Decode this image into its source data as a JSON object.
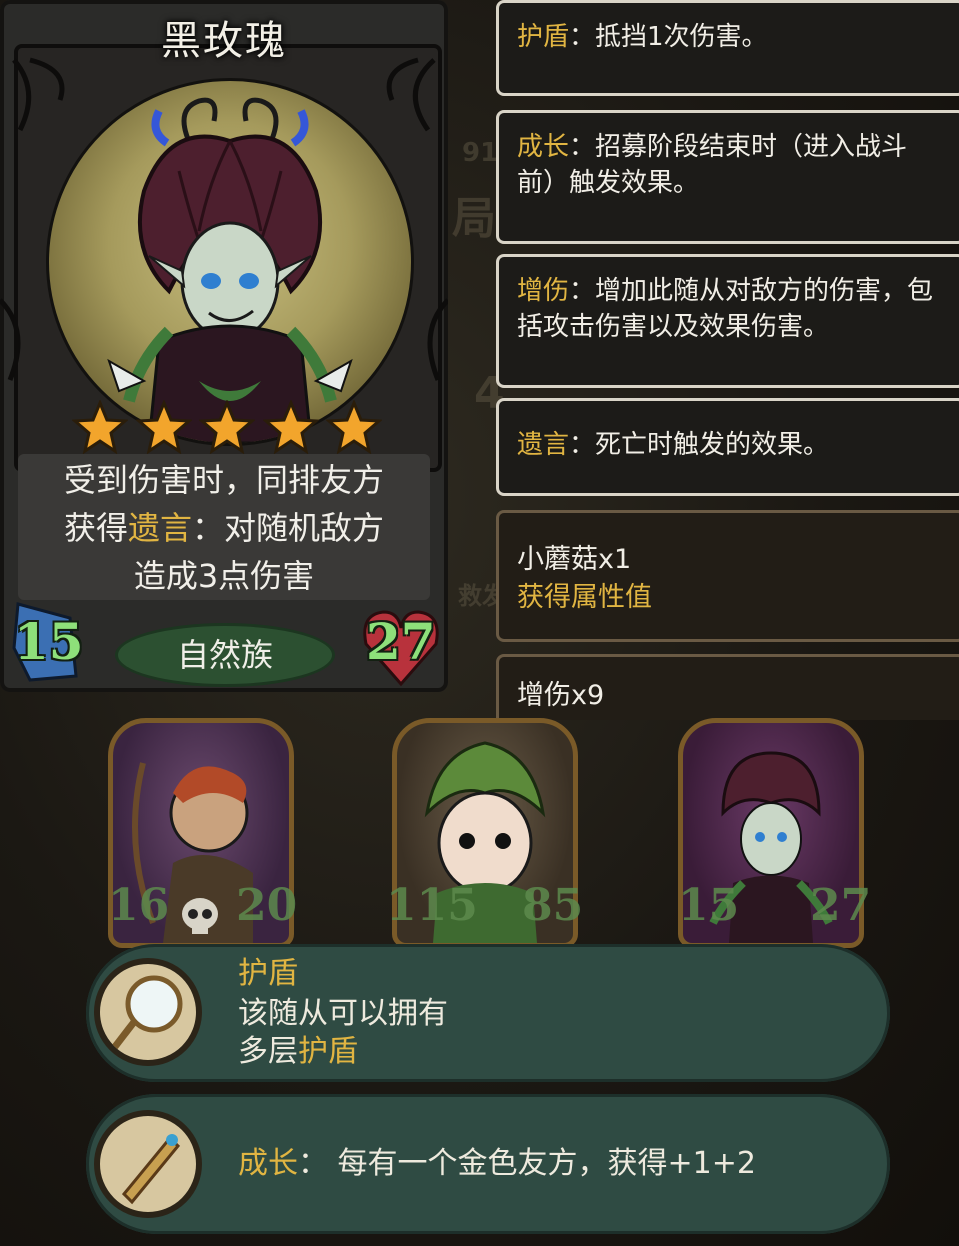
{
  "card": {
    "name": "黑玫瑰",
    "stars": 5,
    "description": {
      "line1": "受到伤害时，同排友方",
      "line2_pre": "获得",
      "line2_key": "遗言",
      "line2_post": "：对随机敌方",
      "line3": "造成3点伤害"
    },
    "attack": "15",
    "health": "27",
    "tribe": "自然族",
    "colors": {
      "stat": "#8ee07a",
      "keyword": "#e1b542",
      "tribe_bg": "#2c5031"
    }
  },
  "keyword_tooltips": [
    {
      "key": "护盾",
      "text": "：抵挡1次伤害。"
    },
    {
      "key": "成长",
      "text": "：招募阶段结束时（进入战斗前）触发效果。"
    },
    {
      "key": "增伤",
      "text": "：增加此随从对敌方的伤害，包括攻击伤害以及效果伤害。"
    },
    {
      "key": "遗言",
      "text": "：死亡时触发的效果。"
    }
  ],
  "buff_tooltips": [
    {
      "line1": "小蘑菇x1",
      "line2": "获得属性值"
    },
    {
      "line1": "增伤x9",
      "line2": ""
    }
  ],
  "minions": [
    {
      "name": "archer",
      "attack": "16",
      "health": "20",
      "icon": "skull-icon"
    },
    {
      "name": "leaf-sprite",
      "attack": "115",
      "health": "85",
      "icon": ""
    },
    {
      "name": "black-rose",
      "attack": "15",
      "health": "27",
      "icon": ""
    }
  ],
  "bubbles": [
    {
      "title": "护盾",
      "line1": "该随从可以拥有",
      "line2_pre": "多层",
      "line2_key": "护盾",
      "icon": "mirror-icon"
    },
    {
      "key": "成长",
      "text": "：  每有一个金色友方，获得+1+2",
      "icon": "dagger-icon"
    }
  ]
}
